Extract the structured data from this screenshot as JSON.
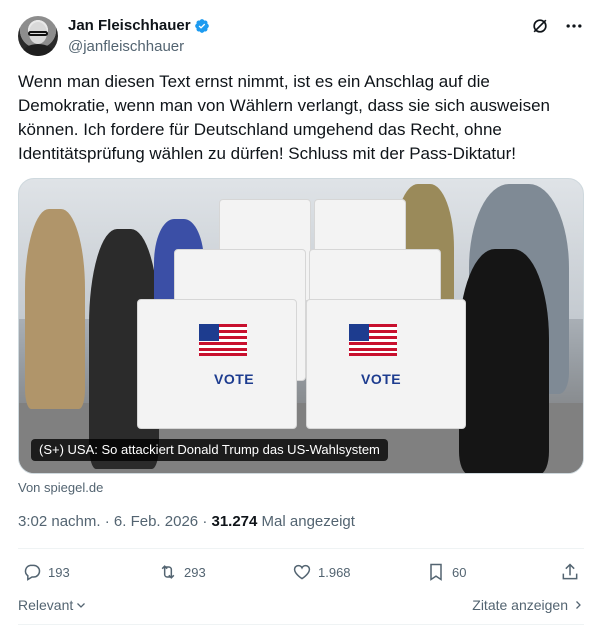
{
  "author": {
    "display_name": "Jan Fleischhauer",
    "handle": "@janfleischhauer"
  },
  "tweet": {
    "text": "Wenn man diesen Text ernst nimmt, ist es ein Anschlag auf die Demokratie, wenn man von Wählern verlangt, dass sie sich ausweisen können. Ich fordere für Deutschland umgehend das Recht, ohne Identitätsprüfung wählen zu dürfen! Schluss mit der Pass-Diktatur!"
  },
  "media": {
    "caption": "(S+) USA: So attackiert Donald Trump das US-Wahlsystem",
    "booth_label": "VOTE"
  },
  "source": "Von spiegel.de",
  "meta": {
    "time": "3:02 nachm.",
    "date": "6. Feb. 2026",
    "views_count": "31.274",
    "views_label": "Mal angezeigt"
  },
  "actions": {
    "replies": "193",
    "reposts": "293",
    "likes": "1.968",
    "bookmarks": "60"
  },
  "footer": {
    "relevant_label": "Relevant",
    "quotes_label": "Zitate anzeigen"
  },
  "colors": {
    "verified": "#1d9bf0",
    "secondary_text": "#536471",
    "primary_text": "#0f1419"
  },
  "icons": [
    "verified-badge-icon",
    "grok-icon",
    "more-icon",
    "reply-icon",
    "repost-icon",
    "like-icon",
    "bookmark-icon",
    "share-icon",
    "chevron-down-icon",
    "chevron-right-icon"
  ]
}
